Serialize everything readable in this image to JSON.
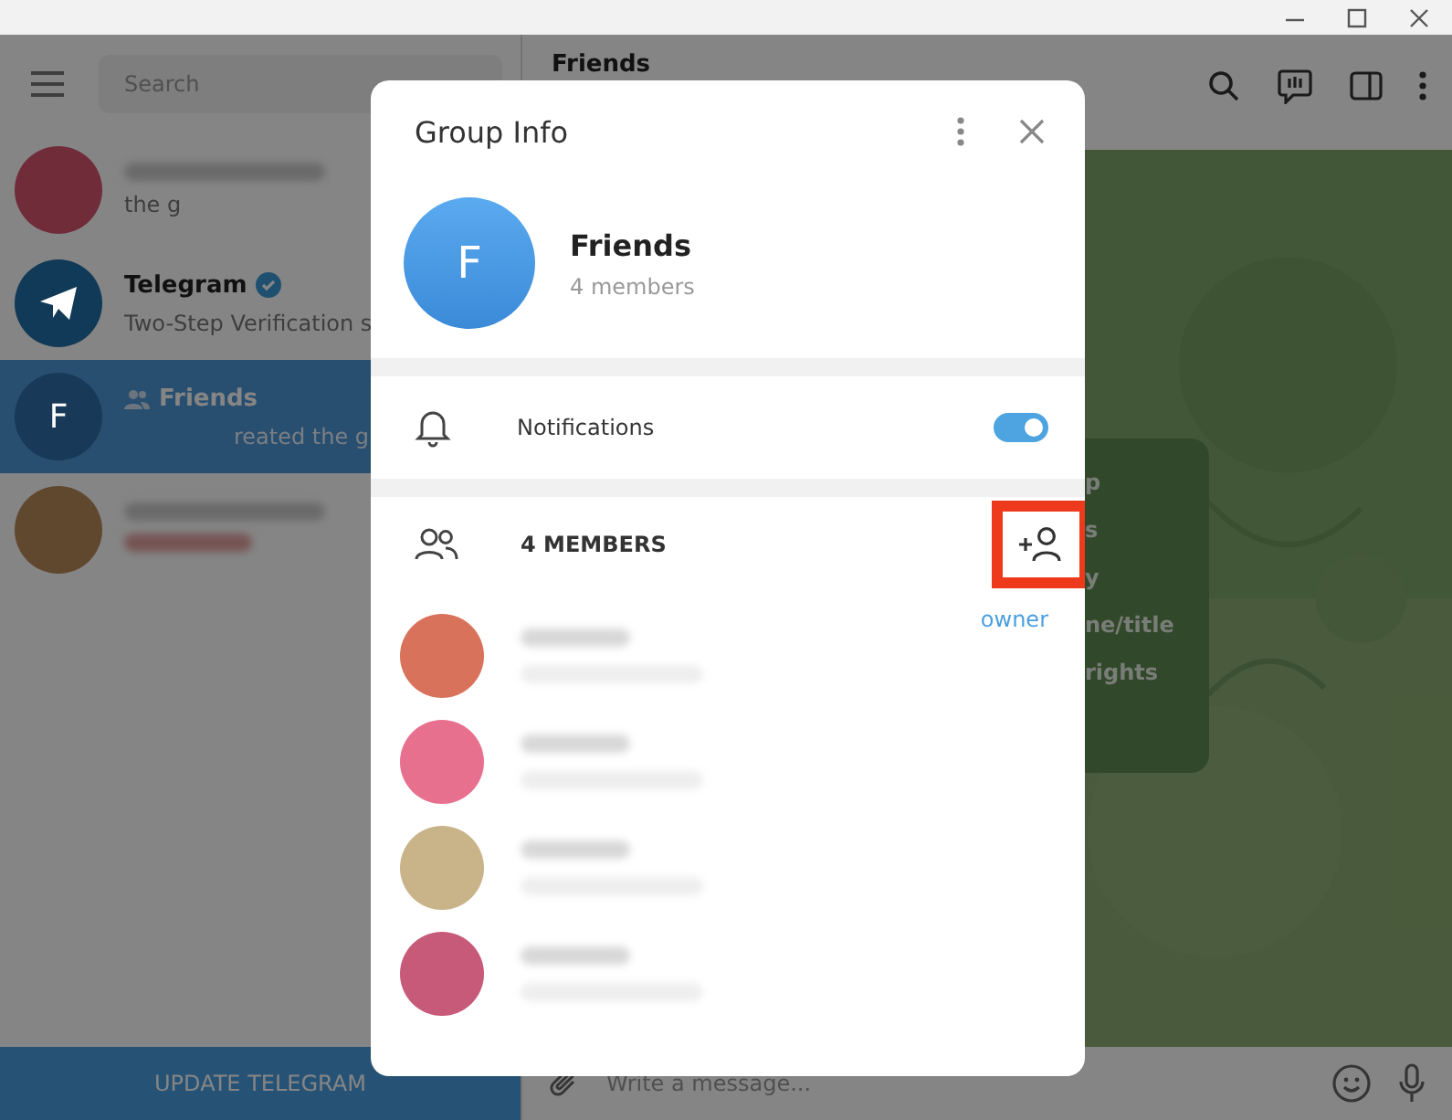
{
  "sidebar": {
    "search": {
      "placeholder": "Search"
    },
    "chats": [
      {
        "preview": "the g",
        "selected": false,
        "color": "#712c3a"
      },
      {
        "name": "Telegram",
        "preview": "Two-Step Verification s",
        "selected": false,
        "color": "#103a57",
        "verified": true
      },
      {
        "name": "Friends",
        "preview": "reated the g",
        "selected": true,
        "color": "#183957",
        "initial": "F",
        "group": true
      },
      {
        "selected": false,
        "color": "#60482f"
      }
    ],
    "update_button": "UPDATE TELEGRAM"
  },
  "chat": {
    "title": "Friends",
    "hint_lines": [
      "p",
      "s",
      "y",
      "ne/title",
      "rights"
    ],
    "composer": {
      "placeholder": "Write a message..."
    }
  },
  "dialog": {
    "title": "Group Info",
    "group": {
      "initial": "F",
      "name": "Friends",
      "subtitle": "4 members"
    },
    "notifications": {
      "label": "Notifications",
      "on": true
    },
    "members_header": "4 MEMBERS",
    "members": [
      {
        "color": "#d9725a",
        "role": "owner"
      },
      {
        "color": "#e8708f"
      },
      {
        "color": "#c9b48a"
      },
      {
        "color": "#c75a78"
      }
    ]
  }
}
